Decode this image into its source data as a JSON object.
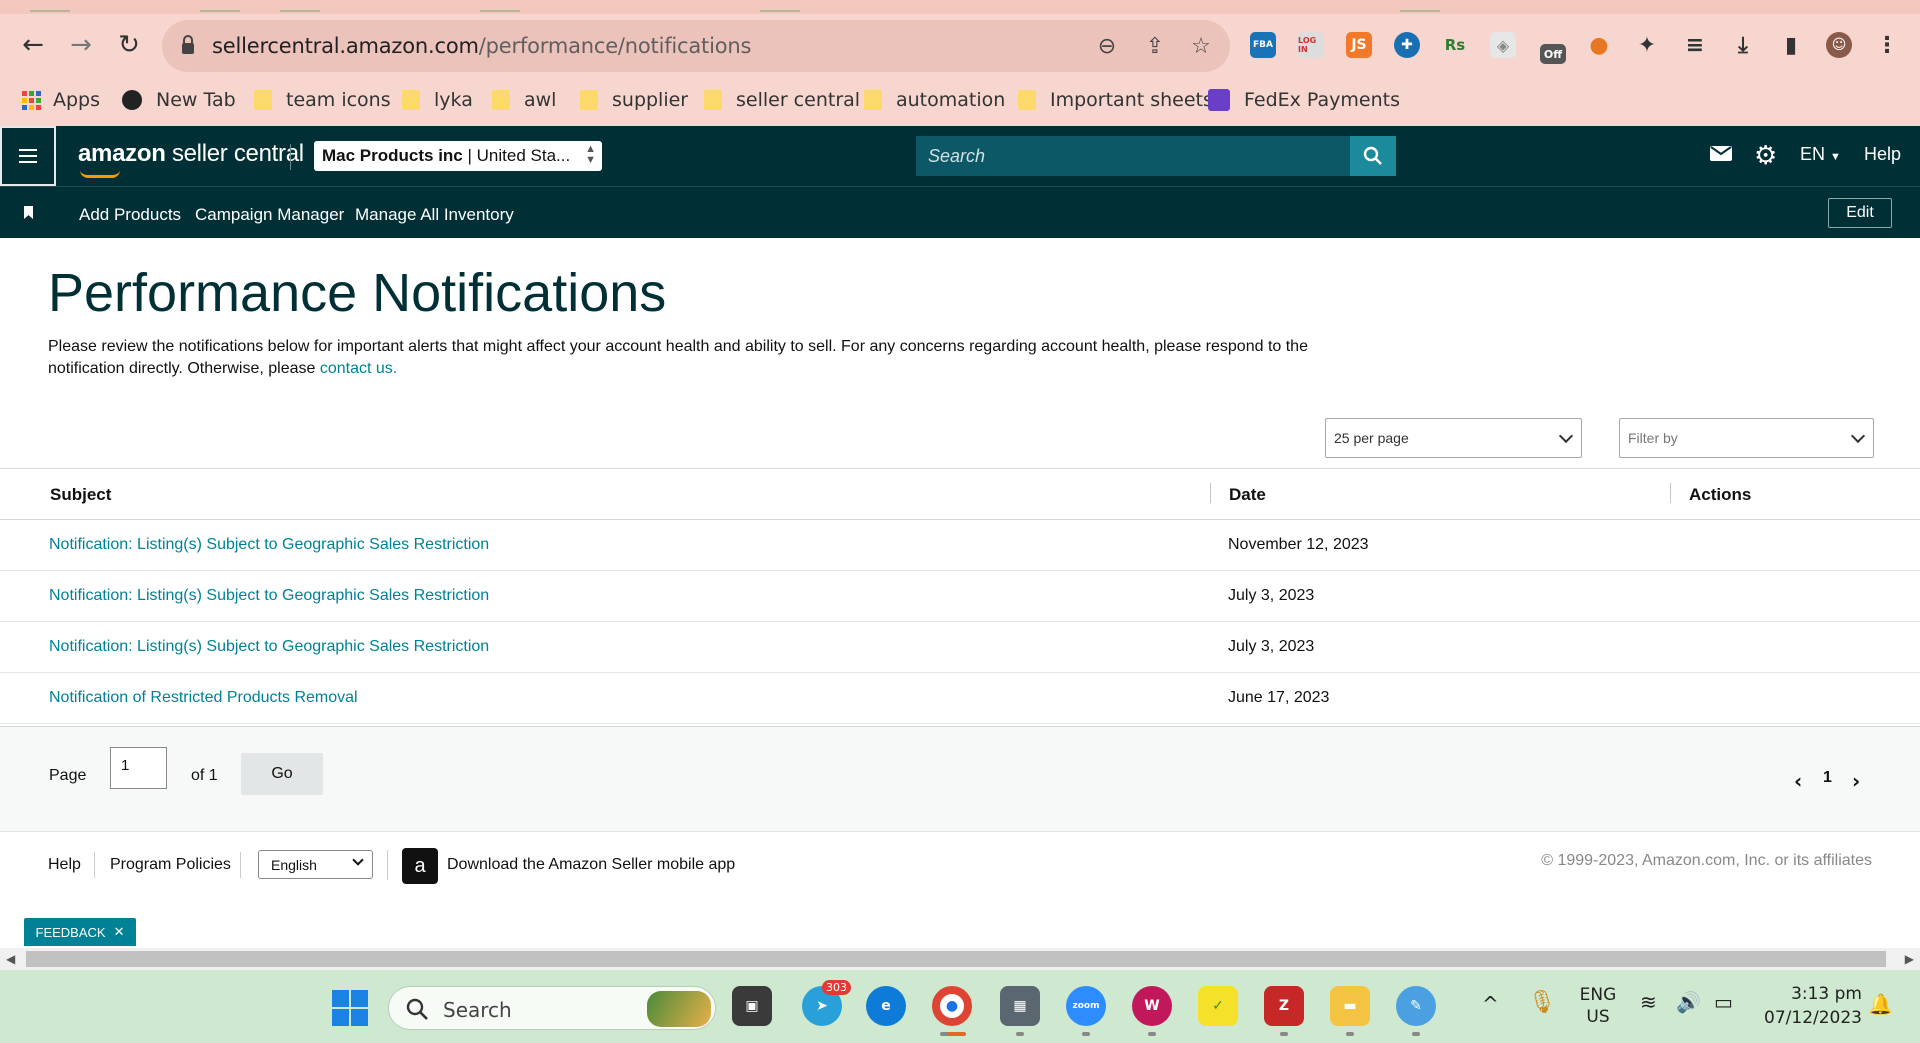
{
  "browser": {
    "url_domain": "sellercentral.amazon.com",
    "url_path": "/performance/notifications",
    "bookmarks": [
      "Apps",
      "New Tab",
      "team icons",
      "lyka",
      "awl",
      "supplier",
      "seller central",
      "automation",
      "Important sheets",
      "FedEx Payments"
    ],
    "extensions": [
      {
        "icon": "fba-icon",
        "label": "FBA",
        "color": "#1a73b7"
      },
      {
        "icon": "login-icon",
        "label": "LOG IN",
        "color": "#777777"
      },
      {
        "icon": "js-icon",
        "label": "JS",
        "color": "#f07a2a"
      },
      {
        "icon": "plus-circle-icon",
        "label": "✚",
        "color": "#1a6fb3"
      },
      {
        "icon": "rs-icon",
        "label": "Rs",
        "color": "#2e7d32"
      },
      {
        "icon": "cube-icon",
        "label": "◈",
        "color": "#8a8a8a"
      },
      {
        "icon": "off-icon",
        "label": "Off",
        "color": "#555555"
      },
      {
        "icon": "orange-dot-icon",
        "label": "●",
        "color": "#e87722"
      }
    ],
    "extension_badge": "Off"
  },
  "header": {
    "logo_brand": "amazon",
    "logo_text": "seller central",
    "account_name": "Mac Products inc",
    "account_region": "United Sta...",
    "search_placeholder": "Search",
    "language": "EN",
    "help": "Help"
  },
  "subnav": {
    "items": [
      "Add Products",
      "Campaign Manager",
      "Manage All Inventory"
    ],
    "edit": "Edit"
  },
  "page": {
    "title": "Performance Notifications",
    "intro": "Please review the notifications below for important alerts that might affect your account health and ability to sell. For any concerns regarding account health, please respond to the notification directly. Otherwise, please ",
    "intro_link": "contact us.",
    "per_page": "25 per page",
    "filter_placeholder": "Filter by"
  },
  "table": {
    "columns": [
      "Subject",
      "Date",
      "Actions"
    ],
    "rows": [
      {
        "subject": "Notification: Listing(s) Subject to Geographic Sales Restriction",
        "date": "November 12, 2023"
      },
      {
        "subject": "Notification: Listing(s) Subject to Geographic Sales Restriction",
        "date": "July 3, 2023"
      },
      {
        "subject": "Notification: Listing(s) Subject to Geographic Sales Restriction",
        "date": "July 3, 2023"
      },
      {
        "subject": "Notification of Restricted Products Removal",
        "date": "June 17, 2023"
      }
    ]
  },
  "pager": {
    "page_label": "Page",
    "page_value": "1",
    "of_label": "of 1",
    "go": "Go",
    "current": "1"
  },
  "footer": {
    "help": "Help",
    "policies": "Program Policies",
    "language": "English",
    "app": "Download the Amazon Seller mobile app",
    "copyright": "© 1999-2023, Amazon.com, Inc. or its affiliates"
  },
  "feedback": "FEEDBACK",
  "taskbar": {
    "search": "Search",
    "telegram_badge": "303",
    "lang_top": "ENG",
    "lang_bottom": "US",
    "time": "3:13 pm",
    "date": "07/12/2023"
  }
}
